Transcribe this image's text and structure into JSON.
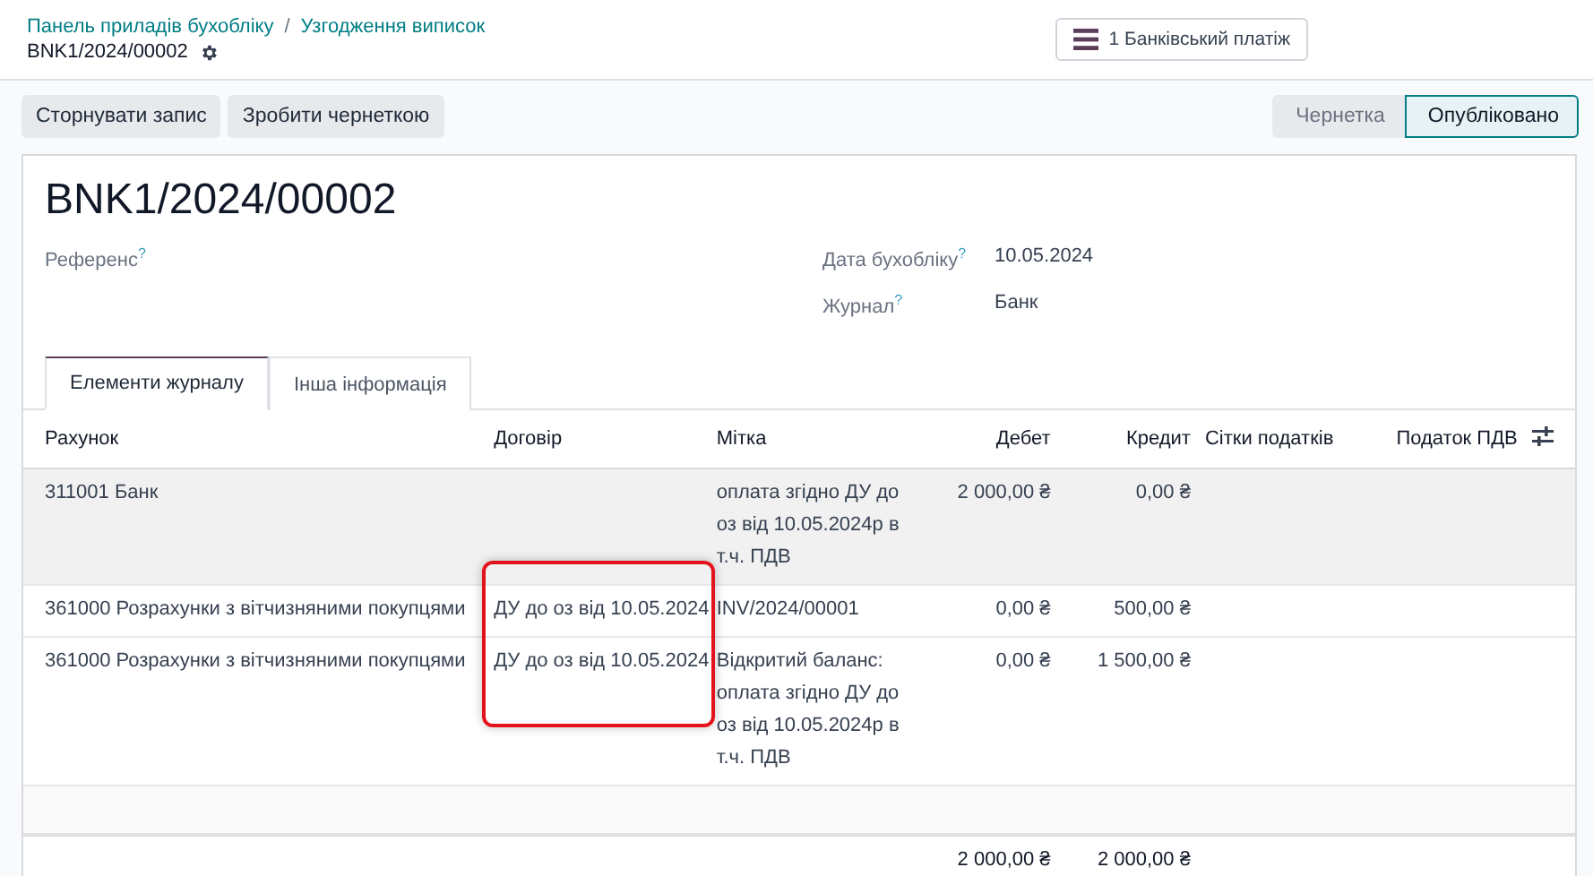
{
  "breadcrumbs": [
    {
      "label": "Панель приладів бухобліку"
    },
    {
      "label": "Узгодження виписок"
    }
  ],
  "breadcrumb_separator": "/",
  "record_name": "BNK1/2024/00002",
  "smart_button": {
    "label": "1 Банківський платіж"
  },
  "action_buttons": [
    "Сторнувати запис",
    "Зробити чернеткою"
  ],
  "status_steps": [
    {
      "label": "Чернетка",
      "selected": false
    },
    {
      "label": "Опубліковано",
      "selected": true
    }
  ],
  "title": "BNK1/2024/00002",
  "left_fields": [
    {
      "label": "Референс$^{?}$"
    }
  ],
  "right_fields": [
    {
      "label": "Дата бухобліку$^{?}$",
      "value": "10.05.2024"
    },
    {
      "label": "Журнал$^{?}$",
      "value": "Банк"
    }
  ],
  "tabs": [
    {
      "label": "Елементи журналу",
      "selected": true
    },
    {
      "label": "Інша інформація",
      "selected": false
    }
  ],
  "table": {
    "columns": [
      "Рахунок",
      "Договір",
      "Мітка",
      "Дебет",
      "Кредит",
      "Сітки податків",
      "Податок ПДВ"
    ],
    "rows": [
      {
        "account": "311001 Банк",
        "label": "оплата згідно ДУ до оз від 10.05.2024р в т.ч. ПДВ",
        "debit": "2 000,00 ₴",
        "credit": "0,00 ₴",
        "selected": true
      },
      {
        "account": "361000 Розрахунки з вітчизняними покупцями",
        "contract": "ДУ до оз від 10.05.2024",
        "label": "INV/2024/00001",
        "debit": "0,00 ₴",
        "credit": "500,00 ₴",
        "selected": false
      },
      {
        "account": "361000 Розрахунки з вітчизняними покупцями",
        "contract": "ДУ до оз від 10.05.2024",
        "label": "Відкритий баланс: оплата згідно ДУ до оз від 10.05.2024р в т.ч. ПДВ",
        "debit": "0,00 ₴",
        "credit": "1 500,00 ₴",
        "selected": false
      }
    ],
    "totals": {
      "debit": "2 000,00 ₴",
      "credit": "2 000,00 ₴"
    }
  }
}
